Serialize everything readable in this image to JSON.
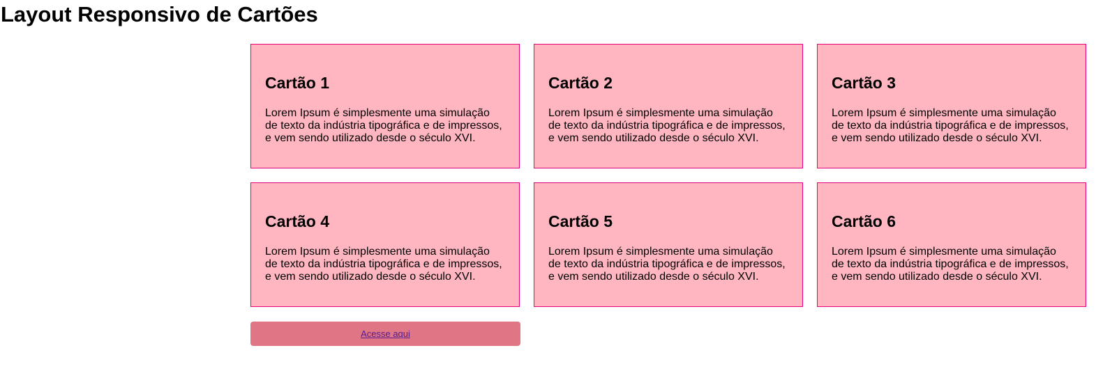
{
  "page": {
    "title": "Layout Responsivo de Cartões"
  },
  "cards": [
    {
      "title": "Cartão 1",
      "text": "Lorem Ipsum é simplesmente uma simulação de texto da indústria tipográfica e de impressos, e vem sendo utilizado desde o século XVI."
    },
    {
      "title": "Cartão 2",
      "text": "Lorem Ipsum é simplesmente uma simulação de texto da indústria tipográfica e de impressos, e vem sendo utilizado desde o século XVI."
    },
    {
      "title": "Cartão 3",
      "text": "Lorem Ipsum é simplesmente uma simulação de texto da indústria tipográfica e de impressos, e vem sendo utilizado desde o século XVI."
    },
    {
      "title": "Cartão 4",
      "text": "Lorem Ipsum é simplesmente uma simulação de texto da indústria tipográfica e de impressos, e vem sendo utilizado desde o século XVI."
    },
    {
      "title": "Cartão 5",
      "text": "Lorem Ipsum é simplesmente uma simulação de texto da indústria tipográfica e de impressos, e vem sendo utilizado desde o século XVI."
    },
    {
      "title": "Cartão 6",
      "text": "Lorem Ipsum é simplesmente uma simulação de texto da indústria tipográfica e de impressos, e vem sendo utilizado desde o século XVI."
    }
  ],
  "cta": {
    "label": "Acesse aqui"
  },
  "colors": {
    "card_background": "#ffb6c1",
    "card_border": "#e6007e",
    "button_background": "#e07585",
    "link": "#551a8b"
  }
}
